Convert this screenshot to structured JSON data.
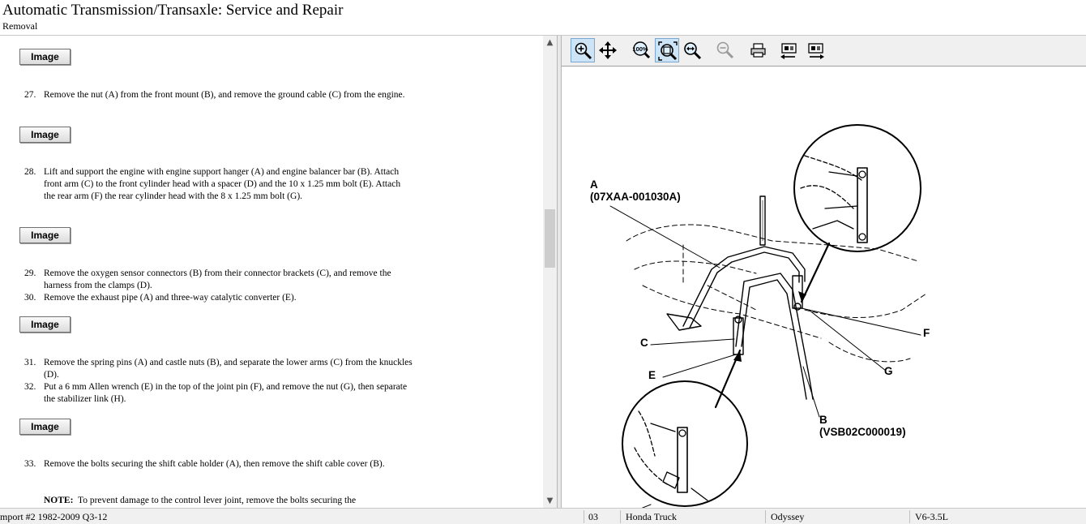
{
  "header": {
    "title": "Automatic Transmission/Transaxle:  Service and Repair",
    "subtitle": "Removal"
  },
  "content": {
    "image_button_label": "Image",
    "steps": [
      {
        "num": "27.",
        "text": "Remove the nut (A) from the front mount (B), and remove the ground cable (C) from the engine."
      },
      {
        "num": "28.",
        "text": "Lift and support the engine with engine support hanger (A) and engine balancer bar (B). Attach front arm (C) to the front cylinder head with a spacer (D) and the 10 x 1.25 mm bolt (E). Attach the rear arm (F) the rear cylinder head with the 8 x 1.25 mm bolt (G)."
      },
      {
        "num": "29.",
        "text": "Remove the oxygen sensor connectors (B) from their connector brackets (C), and remove the harness from the clamps (D)."
      },
      {
        "num": "30.",
        "text": "Remove the exhaust pipe (A) and three-way catalytic converter (E)."
      },
      {
        "num": "31.",
        "text": "Remove the spring pins (A) and castle nuts (B), and separate the lower arms (C) from the knuckles (D)."
      },
      {
        "num": "32.",
        "text": "Put a 6 mm Allen wrench (E) in the top of the joint pin (F), and remove the nut (G), then separate the stabilizer link (H)."
      },
      {
        "num": "33.",
        "text": "Remove the bolts securing the shift cable holder (A), then remove the shift cable cover (B)."
      }
    ],
    "note_label": "NOTE:",
    "note_text": "To prevent damage to the control lever joint, remove the bolts securing the"
  },
  "toolbar": {
    "buttons": [
      "zoom-in-icon",
      "pan-icon",
      "actual-size-icon",
      "fit-window-icon",
      "zoom-area-icon",
      "zoom-out-icon",
      "print-icon",
      "previous-image-icon",
      "next-image-icon"
    ],
    "zoom_label": "100%"
  },
  "diagram": {
    "label_a": "A",
    "label_a_part": "(07XAA-001030A)",
    "label_b": "B",
    "label_b_part": "(VSB02C000019)",
    "label_c": "C",
    "label_e": "E",
    "label_f": "F",
    "label_f2": "F",
    "label_g": "G"
  },
  "status_bar": {
    "source": "mport #2 1982-2009 Q3-12",
    "code": "03",
    "make": "Honda Truck",
    "model": "Odyssey",
    "engine": "V6-3.5L"
  },
  "colors": {
    "toolbar_bg": "#f0f0f0",
    "active_button": "#cde4f7",
    "status_bg": "#f0f0f0"
  }
}
